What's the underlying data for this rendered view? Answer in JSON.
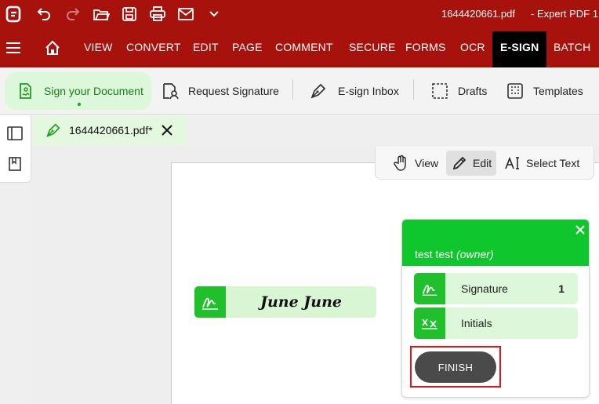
{
  "titlebar": {
    "file_title": "1644420661.pdf",
    "app_title": "-   Expert PDF 1"
  },
  "menu": {
    "items": [
      {
        "label": "VIEW"
      },
      {
        "label": "CONVERT"
      },
      {
        "label": "EDIT"
      },
      {
        "label": "PAGE"
      },
      {
        "label": "COMMENT"
      },
      {
        "label": "SECURE"
      },
      {
        "label": "FORMS"
      },
      {
        "label": "OCR"
      },
      {
        "label": "E-SIGN"
      },
      {
        "label": "BATCH"
      }
    ],
    "active": "E-SIGN"
  },
  "ribbon": {
    "sign_document": "Sign your Document",
    "request_signature": "Request Signature",
    "esign_inbox": "E-sign Inbox",
    "drafts": "Drafts",
    "templates": "Templates"
  },
  "document_tab": {
    "label": "1644420661.pdf*"
  },
  "viewbar": {
    "view": "View",
    "edit": "Edit",
    "select_text": "Select Text"
  },
  "signature_field": {
    "text": "June June"
  },
  "signer_panel": {
    "name": "test test",
    "role": "(owner)",
    "fields": [
      {
        "label": "Signature",
        "count": "1"
      },
      {
        "label": "Initials",
        "count": ""
      }
    ],
    "finish_label": "FINISH"
  },
  "colors": {
    "brand_red": "#a8120c",
    "accent_green": "#0fc72d",
    "highlight_red": "#e0141a"
  }
}
